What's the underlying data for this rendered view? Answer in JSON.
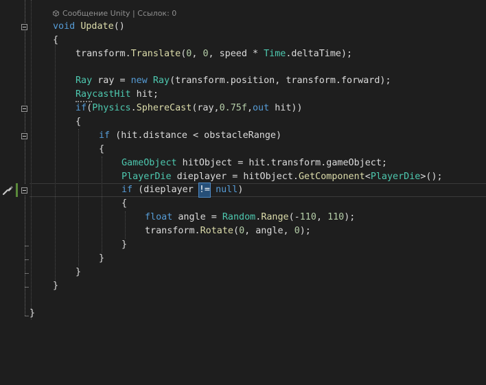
{
  "codelens": "Сообщение Unity | Ссылок: 0",
  "code": {
    "l1": [
      "void",
      " ",
      "Update",
      "()"
    ],
    "l2": "{",
    "l3": [
      "transform",
      ".",
      "Translate",
      "(",
      "0",
      ", ",
      "0",
      ", speed * ",
      "Time",
      ".deltaTime);"
    ],
    "l5": [
      "Ray",
      " ray = ",
      "new",
      " ",
      "Ray",
      "(transform.position, transform.forward);"
    ],
    "l6": [
      "RaycastHit",
      " hit;"
    ],
    "l7": [
      "if",
      "(",
      "Physics",
      ".",
      "SphereCast",
      "(ray,",
      "0.75f",
      ",",
      "out",
      " hit))"
    ],
    "l8": "{",
    "l9": [
      "if",
      " (hit.distance < obstacleRange)"
    ],
    "l10": "{",
    "l11": [
      "GameObject",
      " hitObject = hit.transform.gameObject;"
    ],
    "l12": [
      "PlayerDie",
      " dieplayer = hitObject.",
      "GetComponent",
      "<",
      "PlayerDie",
      ">();"
    ],
    "l13": [
      "if",
      " (dieplayer ",
      "!=",
      " ",
      "null",
      ")"
    ],
    "l14": "{",
    "l15": [
      "float",
      " angle = ",
      "Random",
      ".",
      "Range",
      "(-",
      "110",
      ", ",
      "110",
      ");"
    ],
    "l16": [
      "transform.",
      "Rotate",
      "(",
      "0",
      ", angle, ",
      "0",
      ");"
    ],
    "l17": "}",
    "l18": "}",
    "l19": "}",
    "l20": "}",
    "l22": "}"
  },
  "colors": {
    "background": "#1e1e1e",
    "keyword": "#569cd6",
    "type": "#4ec9b0",
    "method": "#dcdcaa",
    "number": "#b5cea8",
    "text": "#dcdcdc",
    "change_bar": "#5a8a3a"
  },
  "icons": {
    "codelens_icon": "unity-cube-icon",
    "margin_icon": "quick-action-brush-icon",
    "collapse_icon": "collapse-minus-icon"
  }
}
